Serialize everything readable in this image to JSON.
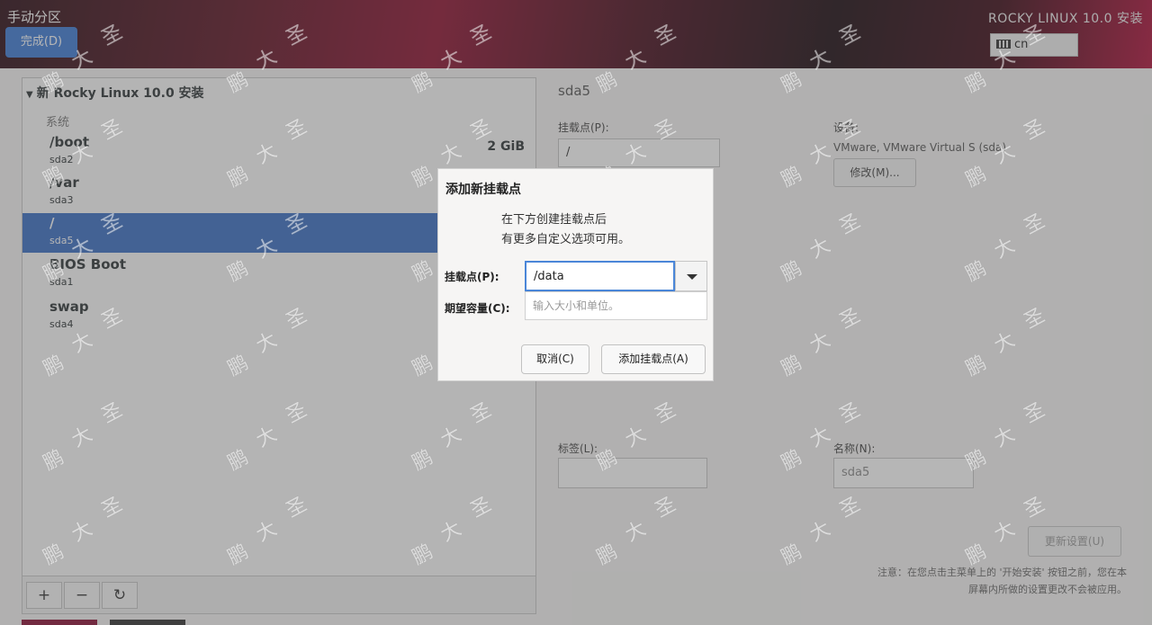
{
  "header": {
    "title": "手动分区",
    "done_label": "完成(D)",
    "product": "ROCKY LINUX 10.0 安装",
    "keyboard_layout": "cn"
  },
  "left": {
    "install_title": "新 Rocky Linux 10.0 安装",
    "system_label": "系统",
    "items": [
      {
        "mount": "/boot",
        "device": "sda2",
        "size": "2 GiB",
        "selected": false
      },
      {
        "mount": "/var",
        "device": "sda3",
        "size": "",
        "selected": false
      },
      {
        "mount": "/",
        "device": "sda5",
        "size": "",
        "selected": true
      },
      {
        "mount": "BIOS Boot",
        "device": "sda1",
        "size": "",
        "selected": false
      },
      {
        "mount": "swap",
        "device": "sda4",
        "size": "",
        "selected": false
      }
    ],
    "toolbar": {
      "add": "+",
      "remove": "−",
      "refresh": "↻"
    }
  },
  "right": {
    "title": "sda5",
    "mount_label": "挂载点(P):",
    "mount_value": "/",
    "device_label": "设备:",
    "device_value": "VMware, VMware Virtual S (sda)",
    "modify_button": "修改(M)...",
    "label_label": "标签(L):",
    "name_label": "名称(N):",
    "name_value": "sda5",
    "update_button": "更新设置(U)",
    "note": "注意：在您点击主菜单上的 '开始安装' 按钮之前，您在本屏幕内所做的设置更改不会被应用。"
  },
  "dialog": {
    "title": "添加新挂载点",
    "message_line1": "在下方创建挂载点后",
    "message_line2": "有更多自定义选项可用。",
    "mount_label": "挂载点(P):",
    "mount_value": "/data",
    "capacity_label": "期望容量(C):",
    "capacity_placeholder": "输入大小和单位。",
    "cancel_label": "取消(C)",
    "add_label": "添加挂载点(A)"
  },
  "watermark": {
    "chars": [
      "鹏",
      "大",
      "圣"
    ]
  },
  "colors": {
    "accent": "#3d7ad6",
    "selected_row": "#3a6fc4",
    "focus_border": "#4a86d8"
  }
}
